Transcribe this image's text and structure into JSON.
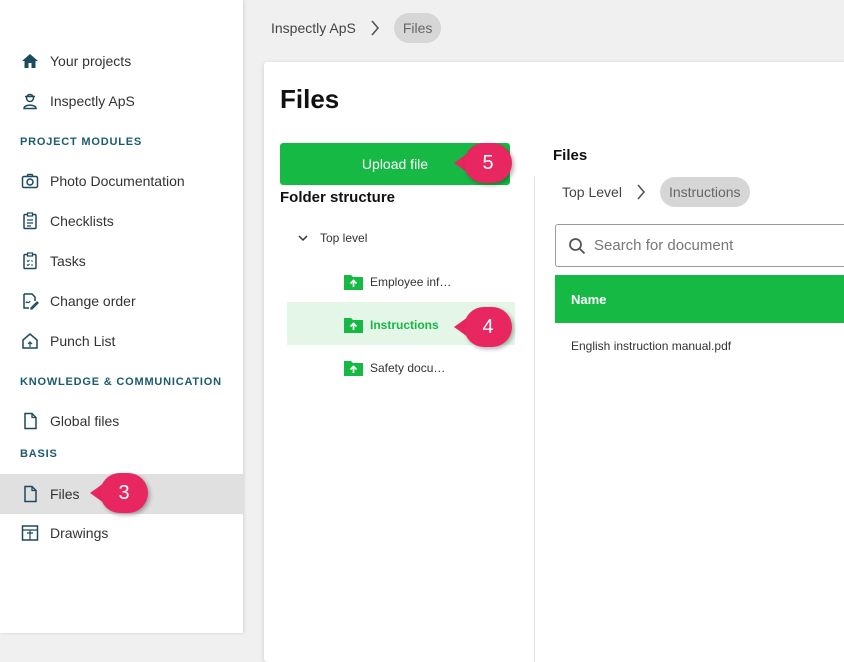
{
  "sidebar": {
    "items": [
      {
        "label": "Your projects",
        "icon": "home-icon"
      },
      {
        "label": "Inspectly ApS",
        "icon": "worker-icon"
      }
    ],
    "sections": [
      {
        "title": "PROJECT MODULES",
        "items": [
          {
            "label": "Photo Documentation",
            "icon": "camera-icon"
          },
          {
            "label": "Checklists",
            "icon": "checklist-icon"
          },
          {
            "label": "Tasks",
            "icon": "tasks-icon"
          },
          {
            "label": "Change order",
            "icon": "change-order-icon"
          },
          {
            "label": "Punch List",
            "icon": "punch-list-icon"
          }
        ]
      },
      {
        "title": "KNOWLEDGE & COMMUNICATION",
        "items": [
          {
            "label": "Global files",
            "icon": "file-icon"
          }
        ]
      },
      {
        "title": "BASIS",
        "items": [
          {
            "label": "Files",
            "icon": "file-icon",
            "active": true
          },
          {
            "label": "Drawings",
            "icon": "drawing-icon"
          }
        ]
      }
    ]
  },
  "topbar": {
    "crumbs": [
      "Inspectly ApS",
      "Files"
    ]
  },
  "main": {
    "title": "Files",
    "upload_label": "Upload file",
    "folder_structure_label": "Folder structure",
    "tree": {
      "root": "Top level",
      "folders": [
        "Employee inf…",
        "Instructions",
        "Safety docu…"
      ],
      "selected": "Instructions"
    },
    "files_panel": {
      "title": "Files",
      "crumbs": [
        "Top Level",
        "Instructions"
      ],
      "search_placeholder": "Search for document",
      "column_header": "Name",
      "rows": [
        "English instruction manual.pdf"
      ]
    }
  },
  "annotations": [
    "3",
    "4",
    "5"
  ],
  "colors": {
    "accent_green": "#17b945",
    "badge_pink": "#e8265f",
    "section_heading": "#1c5a6e"
  }
}
